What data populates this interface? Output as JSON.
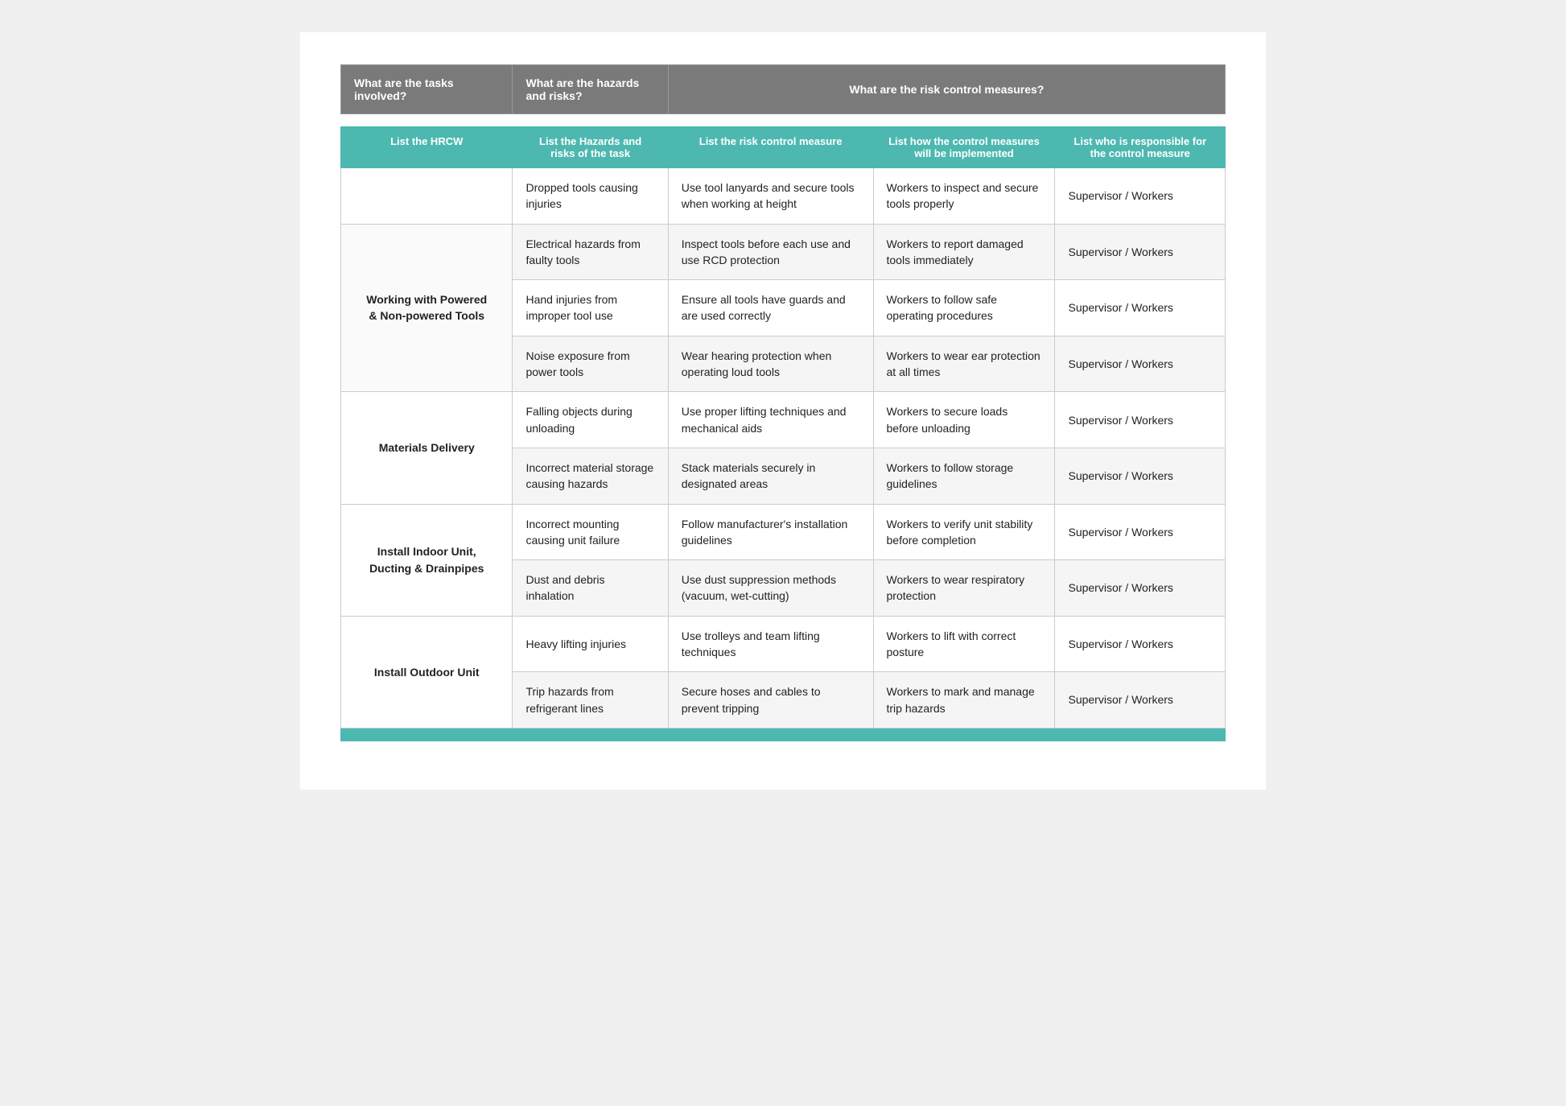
{
  "header": {
    "col1": "What are the tasks involved?",
    "col2": "What are the hazards and risks?",
    "col_merged": "What are the risk control measures?"
  },
  "subheader": {
    "col1": "List the HRCW",
    "col2": "List the Hazards and risks of the task",
    "col3": "List the risk control measure",
    "col4": "List how the control measures will be implemented",
    "col5": "List who is responsible for the control measure"
  },
  "rows": [
    {
      "task": "",
      "hazard": "Dropped tools causing injuries",
      "control": "Use tool lanyards and secure tools when working at height",
      "implementation": "Workers to inspect and secure tools properly",
      "responsible": "Supervisor / Workers"
    },
    {
      "task": "Working with Powered & Non-powered Tools",
      "hazard": "Electrical hazards from faulty tools",
      "control": "Inspect tools before each use and use RCD protection",
      "implementation": "Workers to report damaged tools immediately",
      "responsible": "Supervisor / Workers"
    },
    {
      "task": "",
      "hazard": "Hand injuries from improper tool use",
      "control": "Ensure all tools have guards and are used correctly",
      "implementation": "Workers to follow safe operating procedures",
      "responsible": "Supervisor / Workers"
    },
    {
      "task": "",
      "hazard": "Noise exposure from power tools",
      "control": "Wear hearing protection when operating loud tools",
      "implementation": "Workers to wear ear protection at all times",
      "responsible": "Supervisor / Workers"
    },
    {
      "task": "Materials Delivery",
      "hazard": "Falling objects during unloading",
      "control": "Use proper lifting techniques and mechanical aids",
      "implementation": "Workers to secure loads before unloading",
      "responsible": "Supervisor / Workers"
    },
    {
      "task": "",
      "hazard": "Incorrect material storage causing hazards",
      "control": "Stack materials securely in designated areas",
      "implementation": "Workers to follow storage guidelines",
      "responsible": "Supervisor / Workers"
    },
    {
      "task": "Install Indoor Unit, Ducting & Drainpipes",
      "hazard": "Incorrect mounting causing unit failure",
      "control": "Follow manufacturer's installation guidelines",
      "implementation": "Workers to verify unit stability before completion",
      "responsible": "Supervisor / Workers"
    },
    {
      "task": "",
      "hazard": "Dust and debris inhalation",
      "control": "Use dust suppression methods (vacuum, wet-cutting)",
      "implementation": "Workers to wear respiratory protection",
      "responsible": "Supervisor / Workers"
    },
    {
      "task": "Install Outdoor Unit",
      "hazard": "Heavy lifting injuries",
      "control": "Use trolleys and team lifting techniques",
      "implementation": "Workers to lift with correct posture",
      "responsible": "Supervisor / Workers"
    },
    {
      "task": "",
      "hazard": "Trip hazards from refrigerant lines",
      "control": "Secure hoses and cables to prevent tripping",
      "implementation": "Workers to mark and manage trip hazards",
      "responsible": "Supervisor / Workers"
    }
  ],
  "rowspan_map": {
    "0": 1,
    "1": 3,
    "4": 2,
    "6": 2,
    "8": 2
  }
}
